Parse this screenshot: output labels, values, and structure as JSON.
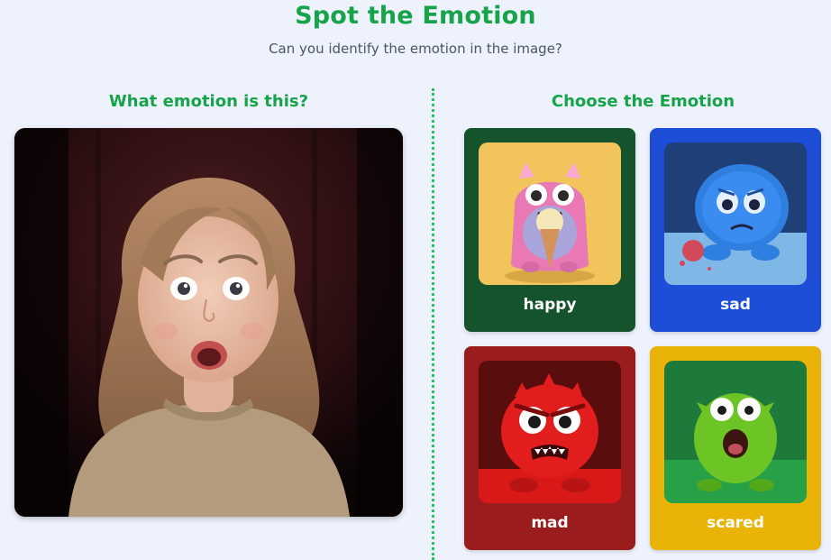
{
  "header": {
    "title": "Spot the Emotion",
    "subtitle": "Can you identify the emotion in the image?"
  },
  "left_panel": {
    "heading": "What emotion is this?",
    "image_alt": "surprised-girl-photo"
  },
  "right_panel": {
    "heading": "Choose the Emotion",
    "choices": [
      {
        "label": "happy",
        "card_color": "#15532d",
        "icon": "pink-monster-ice-cream"
      },
      {
        "label": "sad",
        "card_color": "#1d4ed8",
        "icon": "blue-monster-sad"
      },
      {
        "label": "mad",
        "card_color": "#9b1c1c",
        "icon": "red-monster-angry"
      },
      {
        "label": "scared",
        "card_color": "#eab308",
        "icon": "green-monster-scared"
      }
    ]
  },
  "colors": {
    "accent": "#16a34a",
    "background": "#eef2fc",
    "divider": "#22c55e"
  }
}
